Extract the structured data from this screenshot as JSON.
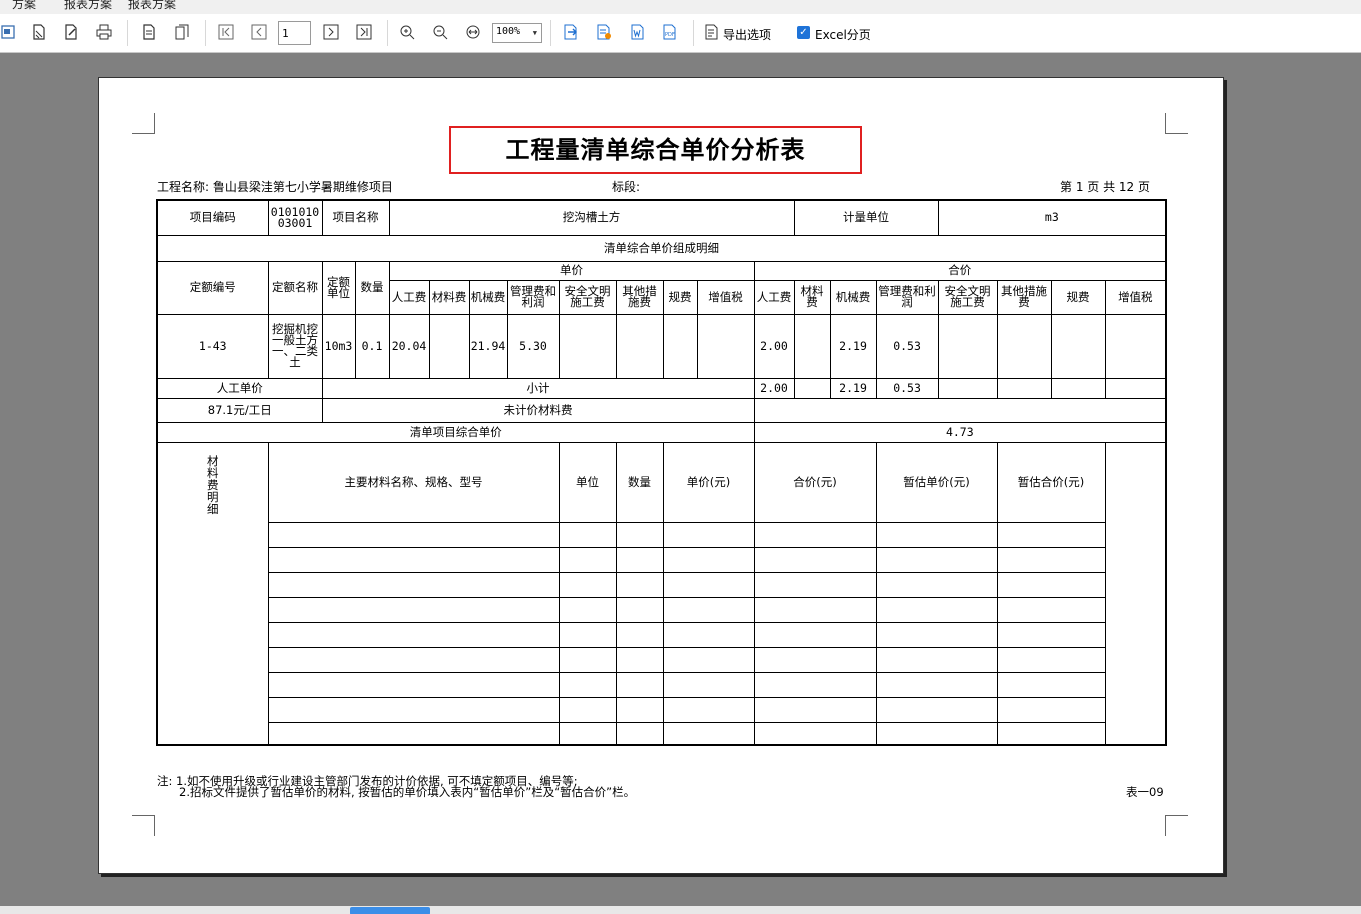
{
  "menubar": {
    "items": [
      "方案",
      "报表方案",
      "报表方案"
    ]
  },
  "toolbar": {
    "page_number": "1",
    "zoom_value": "100%",
    "export_options_label": "导出选项",
    "excel_paging_label": "Excel分页",
    "excel_paging_checked": true
  },
  "report": {
    "title": "工程量清单综合单价分析表",
    "project_name_label": "工程名称: 鲁山县梁洼第七小学暑期维修项目",
    "section_label": "标段:",
    "page_info": "第 1 页  共 12 页",
    "header": {
      "item_code_label": "项目编码",
      "item_code_value": "010101003001",
      "item_name_label": "项目名称",
      "item_name_value": "挖沟槽土方",
      "unit_label": "计量单位",
      "unit_value": "m3"
    },
    "composition_title": "清单综合单价组成明细",
    "columns": {
      "quota_no": "定额编号",
      "quota_name": "定额名称",
      "quota_unit": "定额单位",
      "quantity": "数量",
      "unit_price_group": "单价",
      "total_price_group": "合价",
      "labor": "人工费",
      "material": "材料费",
      "machine": "机械费",
      "mgmt_profit": "管理费和利润",
      "safety": "安全文明施工费",
      "other_measures": "其他措施费",
      "fees": "规费",
      "vat": "增值税"
    },
    "row": {
      "quota_no": "1-43",
      "quota_name": "挖掘机挖一般土方一、二类土",
      "quota_unit": "10m3",
      "quantity": "0.1",
      "u_labor": "20.04",
      "u_material": "",
      "u_machine": "21.94",
      "u_mgmt": "5.30",
      "t_labor": "2.00",
      "t_material": "",
      "t_machine": "2.19",
      "t_mgmt": "0.53"
    },
    "labor_unit_price_label": "人工单价",
    "labor_unit_price_value": "87.1元/工日",
    "subtotal_label": "小计",
    "subtotal": {
      "labor": "2.00",
      "machine": "2.19",
      "mgmt": "0.53"
    },
    "unpriced_material_label": "未计价材料费",
    "composite_price_label": "清单项目综合单价",
    "composite_price_value": "4.73",
    "material_detail": {
      "side_label": "材料费明细",
      "name_col": "主要材料名称、规格、型号",
      "unit_col": "单位",
      "qty_col": "数量",
      "unit_price_col": "单价(元)",
      "total_col": "合价(元)",
      "est_unit_price_col": "暂估单价(元)",
      "est_total_col": "暂估合价(元)"
    },
    "notes": [
      "注: 1.如不使用升级或行业建设主管部门发布的计价依据, 可不填定额项目、编号等;",
      "2.招标文件提供了暂估单价的材料, 按暂估的单价填入表内“暂估单价”栏及“暂估合价”栏。"
    ],
    "table_no": "表一09"
  }
}
